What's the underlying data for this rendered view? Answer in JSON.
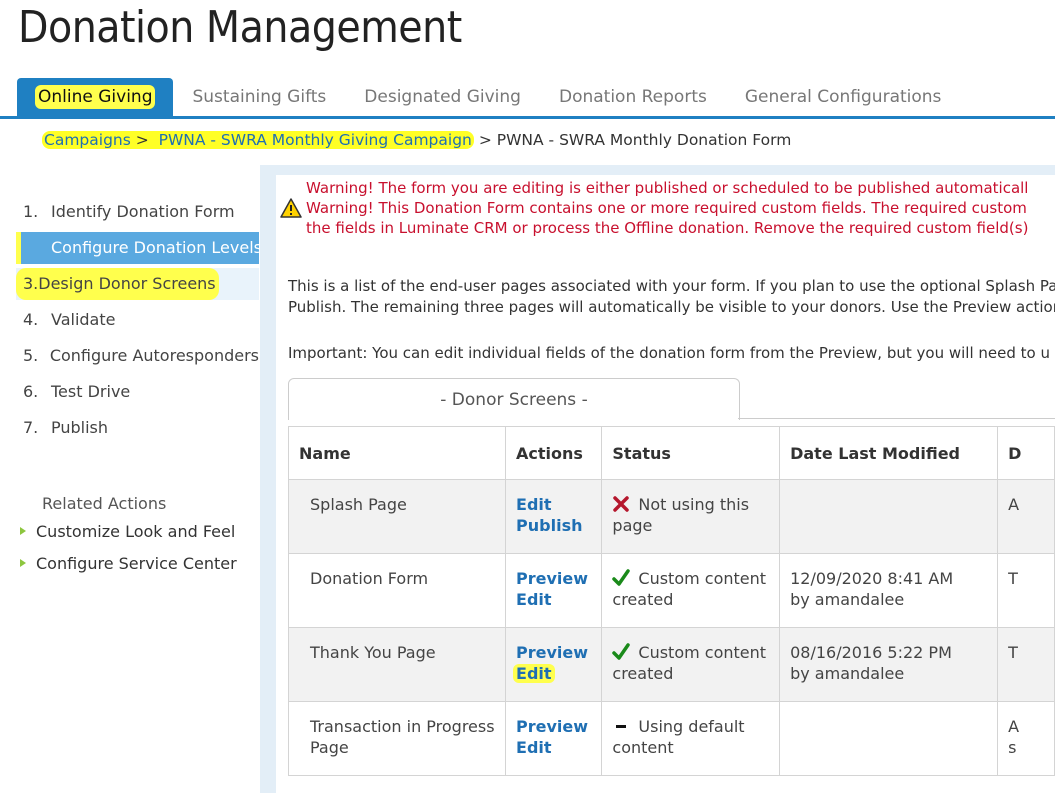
{
  "page_title": "Donation Management",
  "tabs": [
    {
      "label": "Online Giving",
      "active": true
    },
    {
      "label": "Sustaining Gifts",
      "active": false
    },
    {
      "label": "Designated Giving",
      "active": false
    },
    {
      "label": "Donation Reports",
      "active": false
    },
    {
      "label": "General Configurations",
      "active": false
    }
  ],
  "breadcrumb": {
    "campaigns": "Campaigns",
    "campaign": "PWNA - SWRA Monthly Giving Campaign",
    "current": "PWNA - SWRA Monthly Donation Form",
    "separator": ">"
  },
  "steps": [
    {
      "num": "1.",
      "label": "Identify Donation Form"
    },
    {
      "num": "2.",
      "label": "Configure Donation Levels"
    },
    {
      "num": "3.",
      "label": "Design Donor Screens"
    },
    {
      "num": "4.",
      "label": "Validate"
    },
    {
      "num": "5.",
      "label": "Configure Autoresponders"
    },
    {
      "num": "6.",
      "label": "Test Drive"
    },
    {
      "num": "7.",
      "label": "Publish"
    }
  ],
  "related_actions": {
    "heading": "Related Actions",
    "items": [
      "Customize Look and Feel",
      "Configure Service Center"
    ]
  },
  "warnings": [
    "Warning! The form you are editing is either published or scheduled to be published automaticall",
    "Warning! This Donation Form contains one or more required custom fields. The required custom",
    "the fields in Luminate CRM or process the Offline donation. Remove the required custom field(s)"
  ],
  "intro": [
    "This is a list of the end-user pages associated with your form. If you plan to use the optional Splash Pa",
    "Publish. The remaining three pages will automatically be visible to your donors. Use the Preview action",
    "Important: You can edit individual fields of the donation form from the Preview, but you will need to u"
  ],
  "donor_screens_tab": "- Donor Screens -",
  "table": {
    "headers": [
      "Name",
      "Actions",
      "Status",
      "Date Last Modified",
      "D"
    ],
    "rows": [
      {
        "name": "Splash Page",
        "actions": [
          "Edit",
          "Publish"
        ],
        "status_icon": "x-icon",
        "status_l1": "Not using this",
        "status_l2": "page",
        "date": "",
        "by": "",
        "tail1": "A",
        "tail2": ""
      },
      {
        "name": "Donation Form",
        "actions": [
          "Preview",
          "Edit"
        ],
        "status_icon": "check-icon",
        "status_l1": "Custom content",
        "status_l2": "created",
        "date": "12/09/2020 8:41 AM",
        "by": "by amandalee",
        "tail1": "T",
        "tail2": ""
      },
      {
        "name": "Thank You Page",
        "actions": [
          "Preview",
          "Edit"
        ],
        "status_icon": "check-icon",
        "status_l1": "Custom content",
        "status_l2": "created",
        "date": "08/16/2016 5:22 PM",
        "by": "by amandalee",
        "tail1": "T",
        "tail2": ""
      },
      {
        "name": "Transaction in Progress",
        "name2": "Page",
        "actions": [
          "Preview",
          "Edit"
        ],
        "status_icon": "dash-icon",
        "status_l1": "Using default",
        "status_l2": "content",
        "date": "",
        "by": "",
        "tail1": "A",
        "tail2": "s"
      }
    ]
  },
  "colors": {
    "accent": "#1f80c2",
    "link": "#1f6fb3",
    "warning": "#c8102e",
    "highlight": "#ffff4d",
    "check": "#1a8a1a",
    "x": "#b5172d"
  }
}
